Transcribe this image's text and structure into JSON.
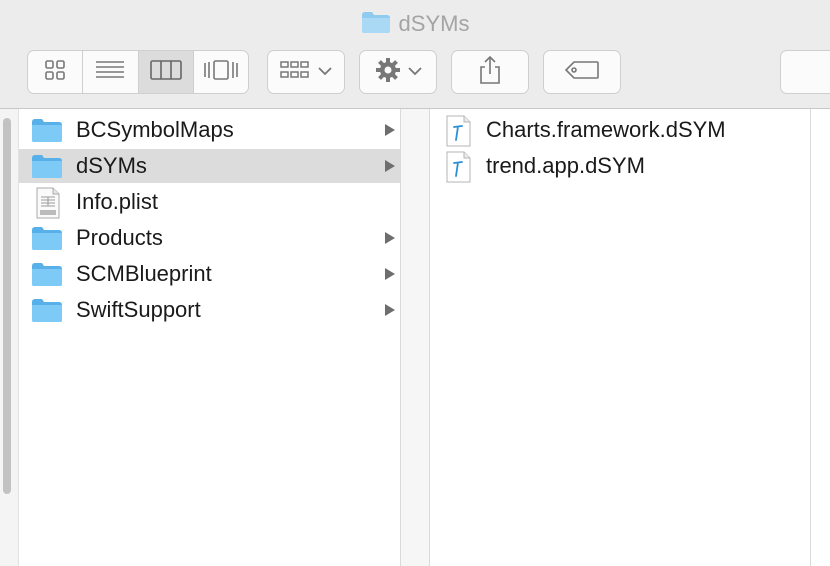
{
  "window": {
    "title": "dSYMs",
    "title_icon": "folder-icon"
  },
  "toolbar": {
    "view_modes": [
      {
        "name": "icon-view",
        "icon": "grid-icon",
        "active": false
      },
      {
        "name": "list-view",
        "icon": "list-icon",
        "active": false
      },
      {
        "name": "column-view",
        "icon": "columns-icon",
        "active": true
      },
      {
        "name": "gallery-view",
        "icon": "coverflow-icon",
        "active": false
      }
    ],
    "arrange_icon": "arrange-grid-icon",
    "action_icon": "gear-icon",
    "share_icon": "share-icon",
    "tags_icon": "tag-icon"
  },
  "columns": [
    {
      "items": [
        {
          "label": "BCSymbolMaps",
          "type": "folder",
          "has_children": true,
          "selected": false
        },
        {
          "label": "dSYMs",
          "type": "folder",
          "has_children": true,
          "selected": true
        },
        {
          "label": "Info.plist",
          "type": "plist",
          "has_children": false,
          "selected": false
        },
        {
          "label": "Products",
          "type": "folder",
          "has_children": true,
          "selected": false
        },
        {
          "label": "SCMBlueprint",
          "type": "folder",
          "has_children": true,
          "selected": false
        },
        {
          "label": "SwiftSupport",
          "type": "folder",
          "has_children": true,
          "selected": false
        }
      ]
    },
    {
      "items": [
        {
          "label": "Charts.framework.dSYM",
          "type": "dsym",
          "has_children": false,
          "selected": false
        },
        {
          "label": "trend.app.dSYM",
          "type": "dsym",
          "has_children": false,
          "selected": false
        }
      ]
    }
  ],
  "colors": {
    "folder_blue": "#6cc0f0",
    "selection": "#dcdcdc",
    "toolbar_bg": "#ececec"
  }
}
